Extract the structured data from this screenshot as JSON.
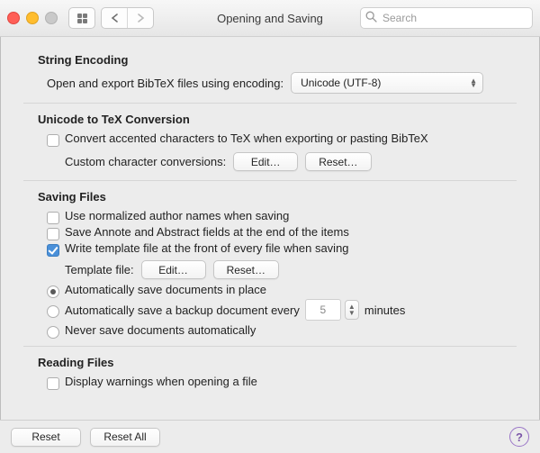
{
  "window": {
    "title": "Opening and Saving"
  },
  "search": {
    "placeholder": "Search"
  },
  "sections": {
    "encoding": {
      "heading": "String Encoding",
      "prompt": "Open and export BibTeX files using encoding:",
      "selected": "Unicode (UTF-8)"
    },
    "unicode": {
      "heading": "Unicode to TeX Conversion",
      "convert_label": "Convert accented characters to TeX when exporting or pasting BibTeX",
      "custom_label": "Custom character conversions:",
      "edit": "Edit…",
      "reset": "Reset…"
    },
    "saving": {
      "heading": "Saving Files",
      "normalize_label": "Use normalized author names when saving",
      "annote_label": "Save Annote and Abstract fields at the end of the items",
      "template_check_label": "Write template file at the front of every file when saving",
      "template_file_label": "Template file:",
      "edit": "Edit…",
      "reset": "Reset…",
      "auto_in_place": "Automatically save documents in place",
      "auto_backup_prefix": "Automatically save a backup document every",
      "auto_backup_value": "5",
      "auto_backup_suffix": "minutes",
      "never": "Never save documents automatically"
    },
    "reading": {
      "heading": "Reading Files",
      "warnings_label": "Display warnings when opening a file"
    }
  },
  "footer": {
    "reset": "Reset",
    "reset_all": "Reset All"
  }
}
